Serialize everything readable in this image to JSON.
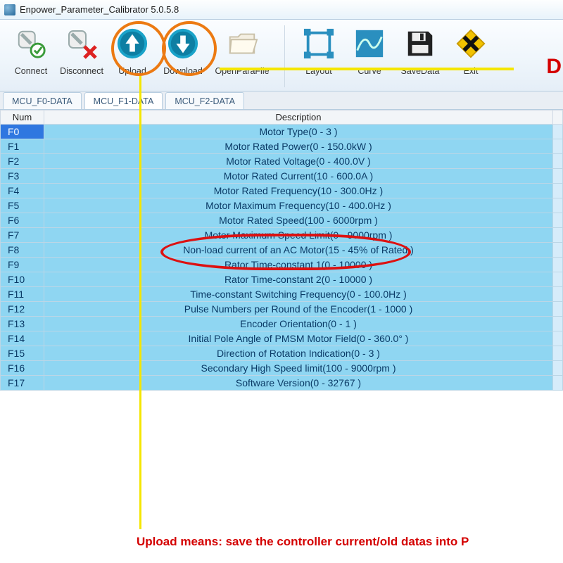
{
  "window": {
    "title": "Enpower_Parameter_Calibrator  5.0.5.8"
  },
  "toolbar": {
    "connect": "Connect",
    "disconnect": "Disconnect",
    "upload": "Upload",
    "download": "Download",
    "openparafile": "OpenParaFile",
    "layout": "Layout",
    "curve": "Curve",
    "savedata": "SaveData",
    "exit": "Exit",
    "truncated_right": "D"
  },
  "tabs": [
    {
      "label": "MCU_F0-DATA",
      "active": false
    },
    {
      "label": "MCU_F1-DATA",
      "active": true
    },
    {
      "label": "MCU_F2-DATA",
      "active": false
    }
  ],
  "table": {
    "headers": {
      "num": "Num",
      "desc": "Description"
    },
    "rows": [
      {
        "num": "F0",
        "desc": "Motor Type(0 - 3 )",
        "selected": true
      },
      {
        "num": "F1",
        "desc": "Motor Rated Power(0 - 150.0kW )"
      },
      {
        "num": "F2",
        "desc": "Motor Rated Voltage(0 - 400.0V )"
      },
      {
        "num": "F3",
        "desc": "Motor Rated Current(10 - 600.0A )"
      },
      {
        "num": "F4",
        "desc": "Motor Rated Frequency(10 - 300.0Hz )"
      },
      {
        "num": "F5",
        "desc": "Motor Maximum Frequency(10 - 400.0Hz )"
      },
      {
        "num": "F6",
        "desc": "Motor Rated Speed(100 - 6000rpm )"
      },
      {
        "num": "F7",
        "desc": "Motor Maximum Speed Limit(0 - 9000rpm )"
      },
      {
        "num": "F8",
        "desc": "Non-load current of an AC Motor(15 - 45% of Rated )"
      },
      {
        "num": "F9",
        "desc": "Rator Time-constant 1(0 - 10000 )"
      },
      {
        "num": "F10",
        "desc": "Rator Time-constant 2(0 - 10000 )"
      },
      {
        "num": "F11",
        "desc": "Time-constant Switching Frequency(0 - 100.0Hz )"
      },
      {
        "num": "F12",
        "desc": "Pulse Numbers per Round of the Encoder(1 - 1000 )"
      },
      {
        "num": "F13",
        "desc": "Encoder Orientation(0 - 1 )"
      },
      {
        "num": "F14",
        "desc": "Initial Pole Angle of PMSM Motor Field(0 - 360.0° )"
      },
      {
        "num": "F15",
        "desc": "Direction of Rotation Indication(0 - 3 )"
      },
      {
        "num": "F16",
        "desc": "Secondary High Speed limit(100 - 9000rpm )"
      },
      {
        "num": "F17",
        "desc": "Software Version(0 - 32767 )"
      }
    ]
  },
  "annotation_caption": "Upload means: save the controller current/old datas into P"
}
